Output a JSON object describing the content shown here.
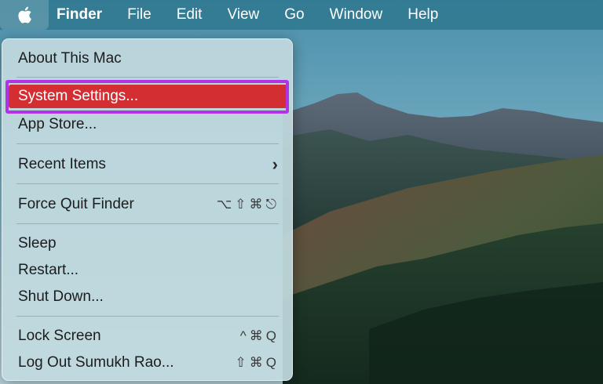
{
  "menubar": {
    "apple_icon": "apple-logo-icon",
    "items": [
      {
        "label": "Finder"
      },
      {
        "label": "File"
      },
      {
        "label": "Edit"
      },
      {
        "label": "View"
      },
      {
        "label": "Go"
      },
      {
        "label": "Window"
      },
      {
        "label": "Help"
      }
    ]
  },
  "apple_menu": {
    "items": [
      {
        "label": "About This Mac"
      },
      {
        "label": "System Settings...",
        "highlighted": true
      },
      {
        "label": "App Store..."
      },
      {
        "label": "Recent Items",
        "submenu_icon": "chevron-right-icon"
      },
      {
        "label": "Force Quit Finder",
        "shortcut": [
          "⌥",
          "⇧",
          "⌘",
          "⎋"
        ]
      },
      {
        "label": "Sleep"
      },
      {
        "label": "Restart..."
      },
      {
        "label": "Shut Down..."
      },
      {
        "label": "Lock Screen",
        "shortcut": [
          "^",
          "⌘",
          "Q"
        ]
      },
      {
        "label": "Log Out Sumukh Rao...",
        "shortcut": [
          "⇧",
          "⌘",
          "Q"
        ]
      }
    ]
  },
  "colors": {
    "menubar_bg": "#307991",
    "highlight_bg": "#d32f33",
    "highlight_frame": "#b232e6",
    "menu_bg": "#c1d9de"
  }
}
